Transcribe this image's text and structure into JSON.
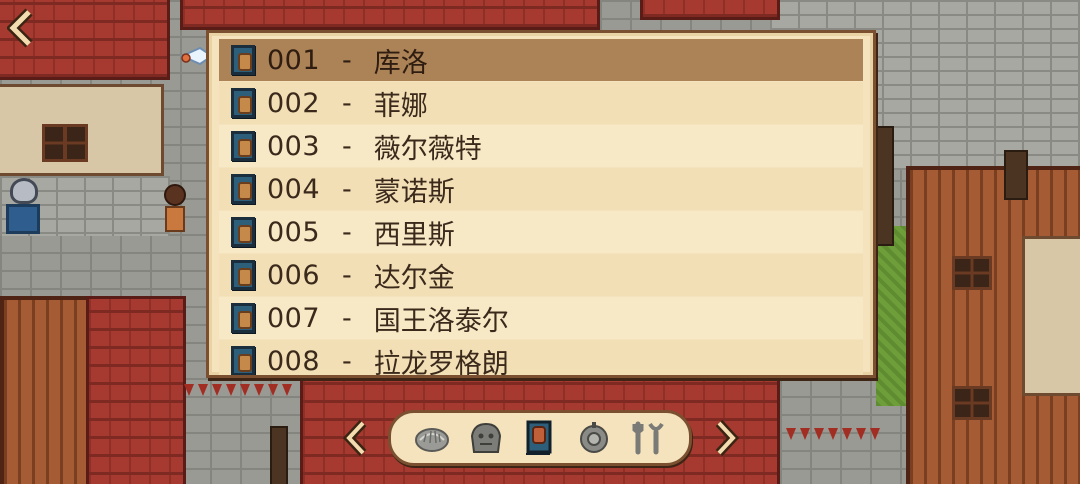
{
  "list": {
    "items": [
      {
        "number": "001",
        "name": "库洛",
        "selected": true
      },
      {
        "number": "002",
        "name": "菲娜",
        "selected": false
      },
      {
        "number": "003",
        "name": "薇尔薇特",
        "selected": false
      },
      {
        "number": "004",
        "name": "蒙诺斯",
        "selected": false
      },
      {
        "number": "005",
        "name": "西里斯",
        "selected": false
      },
      {
        "number": "006",
        "name": "达尔金",
        "selected": false
      },
      {
        "number": "007",
        "name": "国王洛泰尔",
        "selected": false
      },
      {
        "number": "008",
        "name": "拉龙罗格朗",
        "selected": false
      }
    ],
    "separator": "-",
    "item_icon": "character-card-icon"
  },
  "navigation": {
    "back_icon": "chevron-left-icon",
    "prev_icon": "chevron-left-icon",
    "next_icon": "chevron-right-icon"
  },
  "tabs": [
    {
      "icon": "shell-icon",
      "active": false
    },
    {
      "icon": "stone-icon",
      "active": false
    },
    {
      "icon": "character-card-icon",
      "active": true
    },
    {
      "icon": "gear-coin-icon",
      "active": false
    },
    {
      "icon": "tools-icon",
      "active": false
    }
  ],
  "colors": {
    "panel_bg": "#f4e3bd",
    "panel_border": "#7a5030",
    "selected_row": "#ac8257",
    "text": "#3b2a1c"
  }
}
